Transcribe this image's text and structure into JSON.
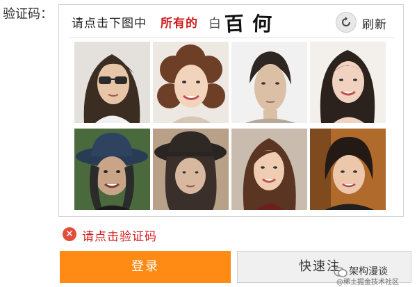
{
  "form": {
    "captcha_label": "验证码："
  },
  "captcha": {
    "instruction": "请点击下图中",
    "instruction_emphasis": "所有的",
    "target_chars": [
      "白",
      "百",
      "何"
    ],
    "refresh_label": "刷新",
    "refresh_icon": "refresh-icon",
    "tiles": [
      {
        "label": "person-sunglasses"
      },
      {
        "label": "woman-curly-hair"
      },
      {
        "label": "woman-plain"
      },
      {
        "label": "woman-smiling-long-hair"
      },
      {
        "label": "person-wide-hat"
      },
      {
        "label": "woman-dark-hat"
      },
      {
        "label": "woman-smiling-brown-hair"
      },
      {
        "label": "woman-short-hair"
      }
    ]
  },
  "error": {
    "icon": "error-icon",
    "message": "请点击验证码"
  },
  "buttons": {
    "login": "登录",
    "quick": "快速注"
  },
  "watermark": {
    "title": "架构漫谈",
    "subtitle": "@稀土掘金技术社区"
  },
  "colors": {
    "accent_orange": "#ff8a14",
    "error_red": "#d11d1d",
    "emphasis_red": "#d11d1d"
  }
}
